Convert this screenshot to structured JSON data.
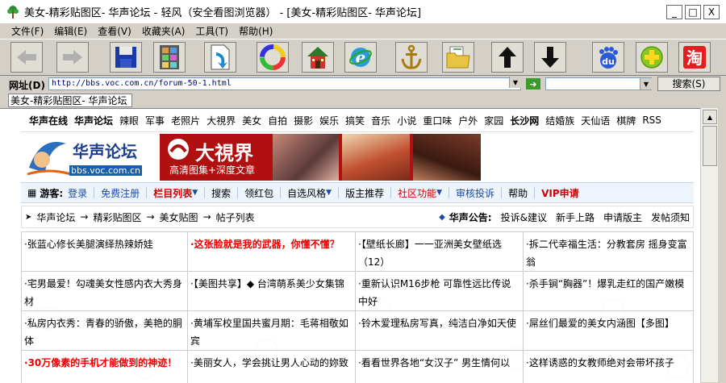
{
  "window": {
    "title": "美女-精彩贴图区- 华声论坛 - 轻风（安全看图浏览器） - [美女-精彩贴图区- 华声论坛]",
    "buttons": [
      "_",
      "□",
      "X"
    ]
  },
  "menu": [
    "文件(F)",
    "编辑(E)",
    "查看(V)",
    "收藏夹(A)",
    "工具(T)",
    "帮助(H)"
  ],
  "toolbar": {
    "icons": [
      "back-icon",
      "forward-icon",
      "save-icon",
      "thumbnails-icon",
      "open-file-icon",
      "refresh-colors-icon",
      "home-icon",
      "ie-icon",
      "anchor-icon",
      "folder-icon",
      "up-arrow-icon",
      "down-arrow-icon",
      "baidu-icon",
      "plus-icon",
      "taobao-icon"
    ],
    "baidu_label": "du",
    "taobao_label": "淘"
  },
  "address": {
    "label": "网址(D)",
    "url": "http://bbs.voc.com.cn/forum-50-1.html",
    "search_label": "搜索(S)"
  },
  "tab": {
    "label": "美女-精彩贴图区- 华声论坛"
  },
  "site": {
    "topnav": [
      "华声在线",
      "华声论坛",
      "辣眼",
      "军事",
      "老照片",
      "大視界",
      "美女",
      "自拍",
      "摄影",
      "娱乐",
      "搞笑",
      "音乐",
      "小说",
      "重口味",
      "户外",
      "家园",
      "长沙网",
      "结婚族",
      "天仙语",
      "棋牌",
      "RSS"
    ],
    "logo_text": "华声论坛",
    "logo_url": "bbs.voc.com.cn",
    "ad_title": "大視界",
    "ad_sub": "高清图集+深度文章",
    "userbar": {
      "guest": "游客:",
      "login": "登录",
      "register": "免费注册",
      "list": "栏目列表",
      "search": "搜索",
      "redpack": "领红包",
      "style": "自选风格",
      "recommend": "版主推荐",
      "community": "社区功能",
      "audit": "审核投诉",
      "help": "帮助",
      "vip": "VIP申请"
    },
    "breadcrumb": [
      "华声论坛",
      "精彩贴图区",
      "美女贴图",
      "帖子列表"
    ],
    "notice_label": "华声公告:",
    "notices": [
      "投诉&建议",
      "新手上路",
      "申请版主",
      "发帖须知"
    ],
    "posts": [
      "张蓝心修长美腿演绎热辣娇娃",
      "这张脸就是我的武器，你懂不懂？",
      "【壁纸长廊】一一亚洲美女壁纸选（12）",
      "拆二代幸福生活：分教套房 摇身变富翁",
      "宅男最爱！勾魂美女性感内衣大秀身材",
      "【美图共享】◆ 台湾萌系美少女集锦",
      "重新认识M16步枪 可靠性远比传说中好",
      "杀手锏“胸器”！爆乳走红的国产嫩模",
      "私房内衣秀：青春的骄傲，美艳的胴体",
      "黄埔军校里国共蜜月期：毛蒋相敬如宾",
      "铃木爱理私房写真，纯洁白净如天使",
      "屌丝们最爱的美女内涵图【多图】",
      "30万像素的手机才能做到的神迹！",
      "美丽女人，学会挑让男人心动的妳致",
      "看看世界各地“女汉子” 男生情何以",
      "这样诱惑的女教师绝对会带坏孩子"
    ],
    "red_posts": [
      1,
      12
    ]
  }
}
